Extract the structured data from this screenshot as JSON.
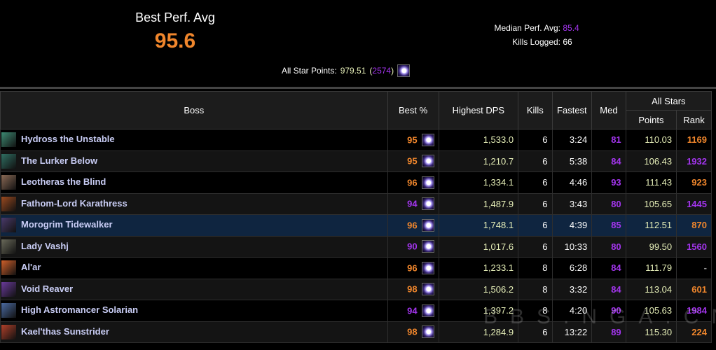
{
  "summary": {
    "best_perf_label": "Best Perf. Avg",
    "best_perf_value": "95.6",
    "median_label": "Median Perf. Avg:",
    "median_value": "85.4",
    "kills_label": "Kills Logged:",
    "kills_value": "66",
    "all_star_label": "All Star Points:",
    "all_star_points": "979.51",
    "all_star_rank": "2574"
  },
  "table": {
    "headers": {
      "boss": "Boss",
      "best": "Best %",
      "dps": "Highest DPS",
      "kills": "Kills",
      "fastest": "Fastest",
      "med": "Med",
      "all_stars": "All Stars",
      "points": "Points",
      "rank": "Rank"
    },
    "rows": [
      {
        "boss": "Hydross the Unstable",
        "best": "95",
        "dps": "1,533.0",
        "kills": "6",
        "fastest": "3:24",
        "med": "81",
        "points": "110.03",
        "rank": "1169",
        "best_color": "orange",
        "rank_color": "orange",
        "icon": "#3c8a72"
      },
      {
        "boss": "The Lurker Below",
        "best": "95",
        "dps": "1,210.7",
        "kills": "6",
        "fastest": "5:38",
        "med": "84",
        "points": "106.43",
        "rank": "1932",
        "best_color": "orange",
        "rank_color": "purple",
        "icon": "#2f6f62"
      },
      {
        "boss": "Leotheras the Blind",
        "best": "96",
        "dps": "1,334.1",
        "kills": "6",
        "fastest": "4:46",
        "med": "93",
        "points": "111.43",
        "rank": "923",
        "best_color": "orange",
        "rank_color": "orange",
        "icon": "#8a6a55"
      },
      {
        "boss": "Fathom-Lord Karathress",
        "best": "94",
        "dps": "1,487.9",
        "kills": "6",
        "fastest": "3:43",
        "med": "80",
        "points": "105.65",
        "rank": "1445",
        "best_color": "purple",
        "rank_color": "purple",
        "icon": "#9a4a20"
      },
      {
        "boss": "Morogrim Tidewalker",
        "best": "96",
        "dps": "1,748.1",
        "kills": "6",
        "fastest": "4:39",
        "med": "85",
        "points": "112.51",
        "rank": "870",
        "best_color": "orange",
        "rank_color": "orange",
        "icon": "#4a3a6a",
        "highlight": true
      },
      {
        "boss": "Lady Vashj",
        "best": "90",
        "dps": "1,017.6",
        "kills": "6",
        "fastest": "10:33",
        "med": "80",
        "points": "99.50",
        "rank": "1560",
        "best_color": "purple",
        "rank_color": "purple",
        "icon": "#6a6a5a"
      },
      {
        "boss": "Al'ar",
        "best": "96",
        "dps": "1,233.1",
        "kills": "8",
        "fastest": "6:28",
        "med": "84",
        "points": "111.79",
        "rank": "-",
        "best_color": "orange",
        "rank_color": "grey",
        "icon": "#d0602a"
      },
      {
        "boss": "Void Reaver",
        "best": "98",
        "dps": "1,506.2",
        "kills": "8",
        "fastest": "3:32",
        "med": "84",
        "points": "113.04",
        "rank": "601",
        "best_color": "orange",
        "rank_color": "orange",
        "icon": "#6a3a9a"
      },
      {
        "boss": "High Astromancer Solarian",
        "best": "94",
        "dps": "1,397.2",
        "kills": "8",
        "fastest": "4:20",
        "med": "90",
        "points": "105.63",
        "rank": "1984",
        "best_color": "purple",
        "rank_color": "purple",
        "icon": "#4a6aa0"
      },
      {
        "boss": "Kael'thas Sunstrider",
        "best": "98",
        "dps": "1,284.9",
        "kills": "6",
        "fastest": "13:22",
        "med": "89",
        "points": "115.30",
        "rank": "224",
        "best_color": "orange",
        "rank_color": "orange",
        "icon": "#b0402a"
      }
    ]
  },
  "colors": {
    "orange": "#f0862c",
    "purple": "#a335ee",
    "dps": "#e6efb8",
    "grey": "#999999"
  },
  "watermark": "BBS.NGA.CN"
}
